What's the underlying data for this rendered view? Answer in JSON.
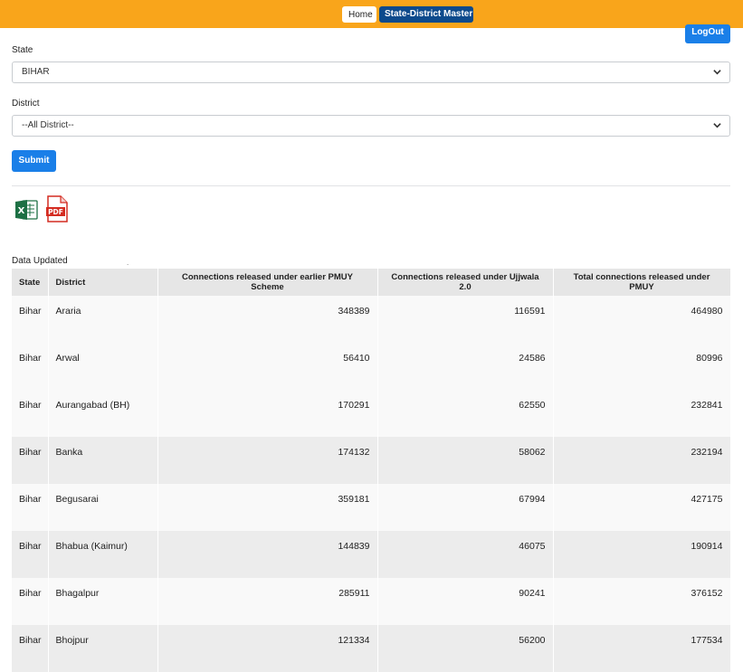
{
  "nav": {
    "home_label": "Home",
    "master_label": "State-District Master",
    "logout_label": "LogOut"
  },
  "form": {
    "state_label": "State",
    "state_value": "BIHAR",
    "district_label": "District",
    "district_value": "--All District--",
    "submit_label": "Submit"
  },
  "export": {
    "excel_icon": "excel-icon",
    "pdf_icon": "pdf-icon",
    "pdf_text": "PDF"
  },
  "data_updated_label": "Data Updated",
  "data_updated_value": ".",
  "table": {
    "columns": [
      "State",
      "District",
      "Connections released under earlier PMUY Scheme",
      "Connections released under Ujjwala 2.0",
      "Total connections released under PMUY"
    ],
    "rows": [
      [
        "Bihar",
        "Araria",
        "348389",
        "116591",
        "464980"
      ],
      [
        "Bihar",
        "Arwal",
        "56410",
        "24586",
        "80996"
      ],
      [
        "Bihar",
        "Aurangabad (BH)",
        "170291",
        "62550",
        "232841"
      ],
      [
        "Bihar",
        "Banka",
        "174132",
        "58062",
        "232194"
      ],
      [
        "Bihar",
        "Begusarai",
        "359181",
        "67994",
        "427175"
      ],
      [
        "Bihar",
        "Bhabua (Kaimur)",
        "144839",
        "46075",
        "190914"
      ],
      [
        "Bihar",
        "Bhagalpur",
        "285911",
        "90241",
        "376152"
      ],
      [
        "Bihar",
        "Bhojpur",
        "121334",
        "56200",
        "177534"
      ]
    ]
  },
  "colors": {
    "topbar": "#f9a51b",
    "primary": "#1a7fe8",
    "nav_active": "#0d4a8c"
  }
}
